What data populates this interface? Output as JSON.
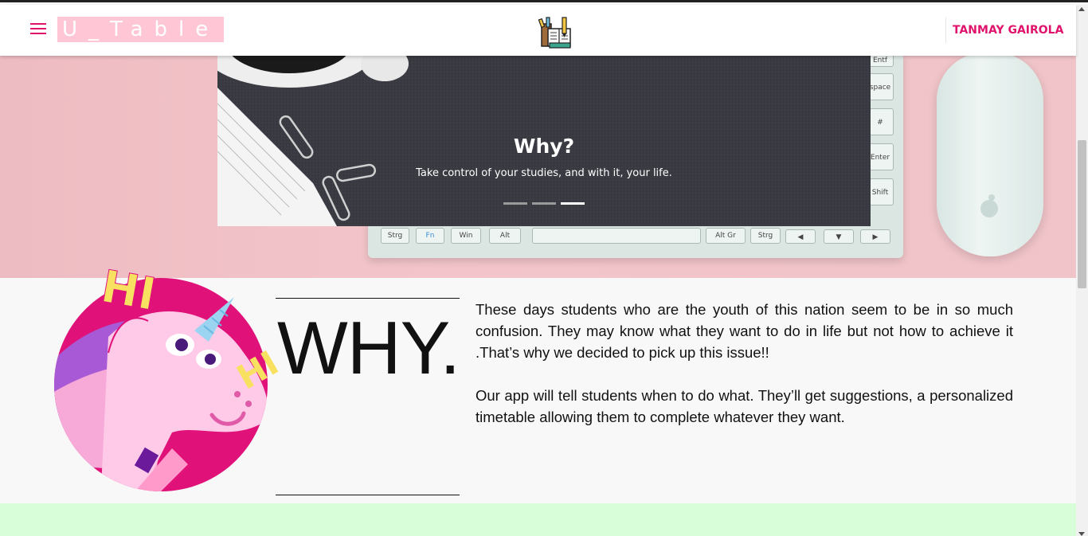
{
  "header": {
    "brand": "U_Table",
    "user_name": "TANMAY GAIROLA",
    "menu_icon": "hamburger-menu-icon",
    "logo_icon": "books-pencil-logo-icon",
    "accent_color": "#e0136c"
  },
  "hero": {
    "carousel": {
      "title": "Why?",
      "caption": "Take control of your studies, and with it, your life.",
      "slide_count": 3,
      "active_slide": 3
    },
    "keyboard_keys": [
      "Strg",
      "Fn",
      "Win",
      "Alt",
      "Alt Gr",
      "Strg",
      "Entf",
      "space",
      "#",
      "Enter",
      "Shift"
    ]
  },
  "why": {
    "heading": "WHY.",
    "paragraph_1": "These days students who are the youth of this nation seem to be in so much confusion. They may know what they want to do in life but not how to achieve it .That’s why we decided to pick up this issue!!",
    "paragraph_2": "Our app will tell students when to do what. They’ll get suggestions, a personalized timetable allowing them to complete whatever they want.",
    "illustration_text": [
      "HI",
      "HI"
    ],
    "illustration_icon": "unicorn-illustration"
  },
  "colors": {
    "hero_bg": "#f0c4c9",
    "green_band": "#d7fed8",
    "brand_bg": "#ffc7d6"
  }
}
